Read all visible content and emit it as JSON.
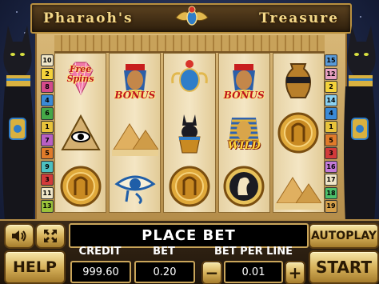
{
  "title": {
    "left": "Pharaoh's",
    "right": "Treasure"
  },
  "paylines": {
    "left": [
      {
        "n": "10",
        "color": "#f0e6c8"
      },
      {
        "n": "2",
        "color": "#f4d23a"
      },
      {
        "n": "8",
        "color": "#d44a8a"
      },
      {
        "n": "4",
        "color": "#3b8ad6"
      },
      {
        "n": "6",
        "color": "#45a848"
      },
      {
        "n": "1",
        "color": "#e8c33a"
      },
      {
        "n": "7",
        "color": "#b85fc4"
      },
      {
        "n": "5",
        "color": "#e07b2a"
      },
      {
        "n": "9",
        "color": "#4cc0c0"
      },
      {
        "n": "3",
        "color": "#d23a3a"
      },
      {
        "n": "11",
        "color": "#f0e6c8"
      },
      {
        "n": "13",
        "color": "#9ac33a"
      }
    ],
    "right": [
      {
        "n": "15",
        "color": "#5a9ad6"
      },
      {
        "n": "12",
        "color": "#e7a0c0"
      },
      {
        "n": "2",
        "color": "#f4d23a"
      },
      {
        "n": "14",
        "color": "#8ad0f0"
      },
      {
        "n": "4",
        "color": "#3b8ad6"
      },
      {
        "n": "1",
        "color": "#e8c33a"
      },
      {
        "n": "5",
        "color": "#e07b2a"
      },
      {
        "n": "3",
        "color": "#d23a3a"
      },
      {
        "n": "16",
        "color": "#c47ad6"
      },
      {
        "n": "17",
        "color": "#f0e6c8"
      },
      {
        "n": "18",
        "color": "#4cc06a"
      },
      {
        "n": "19",
        "color": "#d6a04a"
      }
    ]
  },
  "reels": [
    [
      {
        "symbol": "diamond-free-spins",
        "label": "Free Spins"
      },
      {
        "symbol": "eye-pyramid-icon",
        "label": ""
      },
      {
        "symbol": "gold-coin-icon",
        "label": ""
      }
    ],
    [
      {
        "symbol": "pharaoh-bonus-icon",
        "label": "BONUS"
      },
      {
        "symbol": "pyramids-icon",
        "label": ""
      },
      {
        "symbol": "eye-of-horus-icon",
        "label": ""
      }
    ],
    [
      {
        "symbol": "scarab-amulet-icon",
        "label": ""
      },
      {
        "symbol": "anubis-urn-icon",
        "label": ""
      },
      {
        "symbol": "gold-coin-icon",
        "label": ""
      }
    ],
    [
      {
        "symbol": "pharaoh-bonus-icon",
        "label": "BONUS"
      },
      {
        "symbol": "tutankhamun-wild-icon",
        "label": "WILD"
      },
      {
        "symbol": "cameo-coin-icon",
        "label": ""
      }
    ],
    [
      {
        "symbol": "urn-icon",
        "label": ""
      },
      {
        "symbol": "gold-coin-icon",
        "label": ""
      },
      {
        "symbol": "pyramids-icon",
        "label": ""
      }
    ]
  ],
  "controls": {
    "sound_icon": "speaker-icon",
    "fullscreen_icon": "expand-arrows-icon",
    "help_label": "HELP",
    "message": "PLACE BET",
    "autoplay_label": "AUTOPLAY",
    "start_label": "START",
    "credit_label": "CREDIT",
    "credit_value": "999.60",
    "bet_label": "BET",
    "bet_value": "0.20",
    "bet_per_line_label": "BET PER LINE",
    "bet_per_line_value": "0.01",
    "minus_label": "−",
    "plus_label": "+"
  }
}
